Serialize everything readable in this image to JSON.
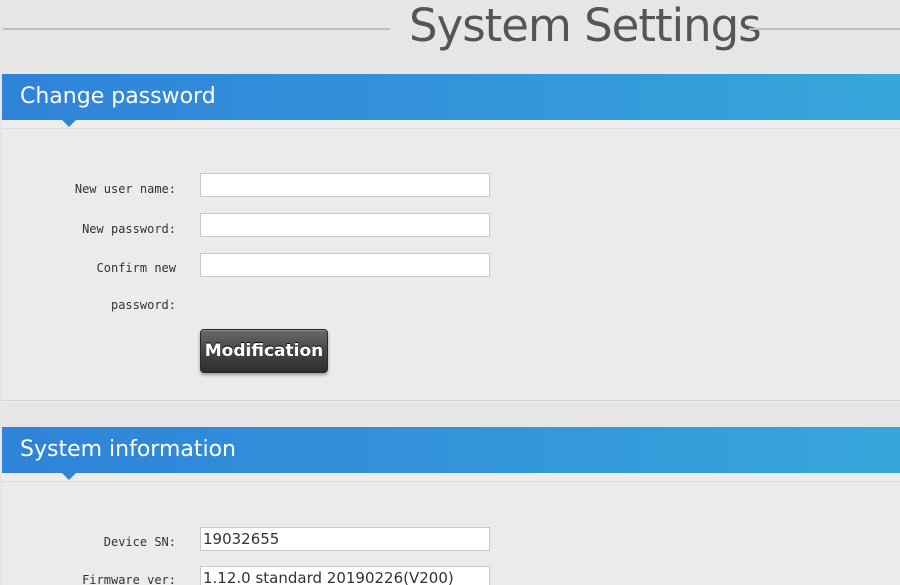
{
  "page": {
    "title": "System Settings"
  },
  "change_password": {
    "header": "Change password",
    "username_label": "New user name:",
    "username_value": "",
    "password_label": "New password:",
    "password_value": "",
    "confirm_label_line1": "Confirm new",
    "confirm_label_line2": "password:",
    "confirm_value": "",
    "submit_label": "Modification"
  },
  "system_information": {
    "header": "System information",
    "device_sn_label": "Device SN:",
    "device_sn_value": "19032655",
    "firmware_label": "Firmware ver:",
    "firmware_value": "1.12.0 standard 20190226(V200)"
  },
  "colors": {
    "header_gradient_start": "#2f83d8",
    "header_gradient_end": "#36a7db",
    "page_background": "#e6e6e6",
    "button_dark": "#3a3a3a"
  }
}
